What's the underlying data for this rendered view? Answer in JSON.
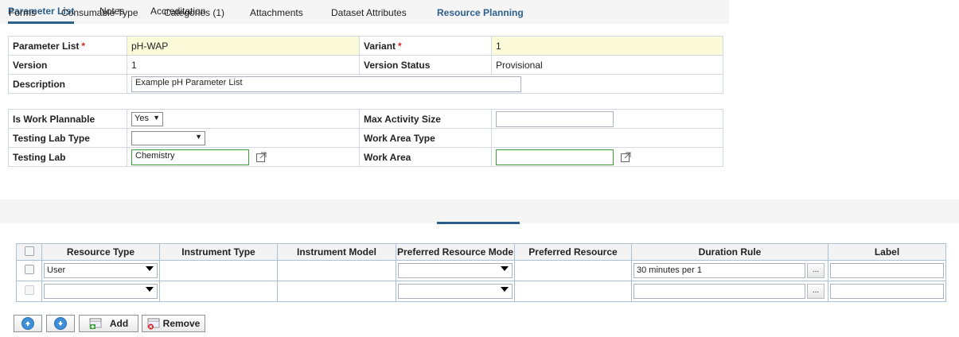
{
  "top_tabs": [
    "Parameter List",
    "Notes",
    "Accreditation"
  ],
  "header_form": {
    "parameter_list_label": "Parameter List",
    "parameter_list_value": "pH-WAP",
    "variant_label": "Variant",
    "variant_value": "1",
    "version_label": "Version",
    "version_value": "1",
    "version_status_label": "Version Status",
    "version_status_value": "Provisional",
    "description_label": "Description",
    "description_value": "Example pH Parameter List",
    "required_marker": "*"
  },
  "planning_form": {
    "is_work_plannable_label": "Is Work Plannable",
    "is_work_plannable_value": "Yes",
    "max_activity_size_label": "Max Activity Size",
    "max_activity_size_value": "",
    "testing_lab_type_label": "Testing Lab Type",
    "testing_lab_type_value": "",
    "work_area_type_label": "Work Area Type",
    "testing_lab_label": "Testing Lab",
    "testing_lab_value": "Chemistry",
    "work_area_label": "Work Area",
    "work_area_value": ""
  },
  "sub_tabs": [
    "Forms",
    "Consumable Type",
    "Categories (1)",
    "Attachments",
    "Dataset Attributes",
    "Resource Planning"
  ],
  "resource_table": {
    "columns": [
      "Resource Type",
      "Instrument Type",
      "Instrument Model",
      "Preferred Resource Mode",
      "Preferred Resource",
      "Duration Rule",
      "Label"
    ],
    "rows": [
      {
        "resource_type": "User",
        "preferred_resource_mode": "",
        "duration_rule": "30 minutes per 1",
        "label": ""
      },
      {
        "resource_type": "",
        "preferred_resource_mode": "",
        "duration_rule": "",
        "label": ""
      }
    ],
    "ellipsis": "..."
  },
  "buttons": {
    "add": "Add",
    "remove": "Remove"
  },
  "colors": {
    "accent": "#2b5f8c",
    "required": "#d9262c",
    "highlight": "#fcfbd9"
  }
}
